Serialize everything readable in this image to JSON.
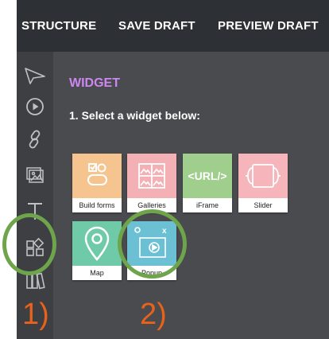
{
  "topbar": {
    "structure_label": "STRUCTURE",
    "save_draft_label": "SAVE DRAFT",
    "preview_draft_label": "PREVIEW DRAFT"
  },
  "sidebar": {
    "tools": [
      "select-arrow-icon",
      "play-circle-icon",
      "link-icon",
      "image-gallery-icon",
      "text-icon",
      "widget-icon",
      "columns-icon"
    ]
  },
  "panel": {
    "title": "WIDGET",
    "instruction": "1. Select a widget below:",
    "widgets": [
      {
        "label": "Build forms",
        "color": "#f6c48e",
        "icon": "form-icon"
      },
      {
        "label": "Galleries",
        "color": "#f3b1b6",
        "icon": "gallery-icon"
      },
      {
        "label": "iFrame",
        "color": "#9fce8d",
        "icon": "url-tag-icon",
        "icon_text": "<URL/>"
      },
      {
        "label": "Slider",
        "color": "#f6b5bb",
        "icon": "slider-icon"
      },
      {
        "label": "Map",
        "color": "#6fcba7",
        "icon": "map-pin-icon"
      },
      {
        "label": "Popup",
        "color": "#6cc0d4",
        "icon": "popup-icon",
        "icon_text": "x"
      }
    ]
  },
  "annotations": {
    "step1": "1)",
    "step2": "2)",
    "accent_orange": "#e8621c",
    "circle_green": "#6ea54a"
  }
}
